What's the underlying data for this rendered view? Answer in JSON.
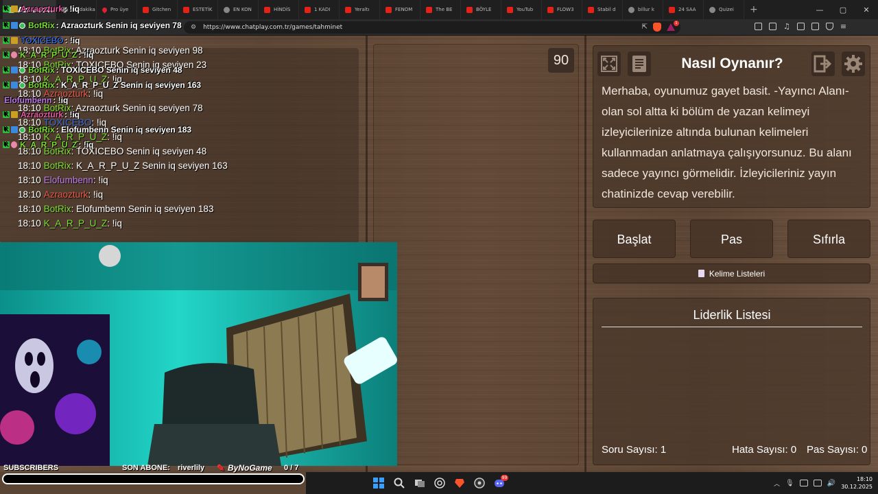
{
  "browser": {
    "tabs": [
      {
        "label": "Azraozturk: !iq",
        "icon": "twitch-icon",
        "active": true
      },
      {
        "label": "Bir dakika",
        "icon": "globe-icon"
      },
      {
        "label": "Pro üye",
        "icon": "pin-icon"
      },
      {
        "label": "Gitchen",
        "icon": "youtube-icon"
      },
      {
        "label": "ESTETİK",
        "icon": "youtube-icon"
      },
      {
        "label": "EN KON",
        "icon": "globe-icon"
      },
      {
        "label": "HİNDİS",
        "icon": "youtube-icon"
      },
      {
        "label": "1 KADI",
        "icon": "youtube-icon"
      },
      {
        "label": "Yeraltı",
        "icon": "youtube-icon"
      },
      {
        "label": "FENOM",
        "icon": "youtube-icon"
      },
      {
        "label": "The BE",
        "icon": "youtube-icon"
      },
      {
        "label": "BÖYLE",
        "icon": "youtube-icon"
      },
      {
        "label": "YouTub",
        "icon": "youtube-icon"
      },
      {
        "label": "FLOW3",
        "icon": "youtube-icon"
      },
      {
        "label": "Stabil d",
        "icon": "youtube-icon"
      },
      {
        "label": "billur k",
        "icon": "globe-icon"
      },
      {
        "label": "24 SAA",
        "icon": "youtube-icon"
      },
      {
        "label": "Quizei",
        "icon": "globe-icon"
      }
    ],
    "url": "https://www.chatplay.com.tr/games/tahminet",
    "shield_badge": "1"
  },
  "overlay_chat": [
    {
      "user": "Azraozturk",
      "msg": ": !iq",
      "color": "#e65aa4",
      "badges": [
        "sub",
        "crown"
      ]
    },
    {
      "user": "BotRix",
      "msg": ": Azraozturk Senin iq seviyen 78",
      "color": "#7dde33",
      "badges": [
        "k",
        "s",
        "v"
      ]
    },
    {
      "user": "TOXICEBO",
      "msg": ": !iq",
      "color": "#3a6bd6",
      "badges": [
        "k",
        "c"
      ]
    },
    {
      "user": "K_A_R_P_U_Z",
      "msg": ": !iq",
      "color": "#7dde33",
      "badges": [
        "k",
        "p"
      ]
    },
    {
      "user": "BotRix",
      "msg": ": TOXICEBO Senin iq seviyen 48",
      "color": "#7dde33",
      "badges": [
        "k",
        "s",
        "v"
      ]
    },
    {
      "user": "BotRix",
      "msg": ": K_A_R_P_U_Z Senin iq seviyen 163",
      "color": "#7dde33",
      "badges": [
        "k",
        "s",
        "v"
      ]
    },
    {
      "user": "Elofumbenn",
      "msg": ": !iq",
      "color": "#c07dea",
      "badges": []
    },
    {
      "user": "Azraozturk",
      "msg": ": !iq",
      "color": "#e65aa4",
      "badges": [
        "k",
        "c"
      ]
    },
    {
      "user": "BotRix",
      "msg": ": Elofumbenn Senin iq seviyen 183",
      "color": "#7dde33",
      "badges": [
        "k",
        "s",
        "v"
      ]
    },
    {
      "user": "K_A_R_P_U_Z",
      "msg": ": !iq",
      "color": "#7dde33",
      "badges": [
        "k",
        "p"
      ]
    }
  ],
  "game_chat": [
    {
      "time": "18:10",
      "user": "BotRix",
      "msg": ": Azraozturk Senin iq seviyen 98",
      "cls": "u-green"
    },
    {
      "time": "18:10",
      "user": "BotRix",
      "msg": ": TOXICEBO Senin iq seviyen 23",
      "cls": "u-green"
    },
    {
      "time": "18:10",
      "user": "K_A_R_P_U_Z",
      "msg": ": !iq",
      "cls": "u-green"
    },
    {
      "time": "18:10",
      "user": "Azraozturk",
      "msg": ": !iq",
      "cls": "u-red"
    },
    {
      "time": "18:10",
      "user": "BotRix",
      "msg": ": Azraozturk Senin iq seviyen 78",
      "cls": "u-green"
    },
    {
      "time": "18:10",
      "user": "TOXICEBO",
      "msg": ": !iq",
      "cls": "u-blue"
    },
    {
      "time": "18:10",
      "user": "K_A_R_P_U_Z",
      "msg": ": !iq",
      "cls": "u-green"
    },
    {
      "time": "18:10",
      "user": "BotRix",
      "msg": ": TOXICEBO Senin iq seviyen 48",
      "cls": "u-green"
    },
    {
      "time": "18:10",
      "user": "BotRix",
      "msg": ": K_A_R_P_U_Z Senin iq seviyen 163",
      "cls": "u-green"
    },
    {
      "time": "18:10",
      "user": "Elofumbenn",
      "msg": ": !iq",
      "cls": "u-purple"
    },
    {
      "time": "18:10",
      "user": "Azraozturk",
      "msg": ": !iq",
      "cls": "u-red"
    },
    {
      "time": "18:10",
      "user": "BotRix",
      "msg": ": Elofumbenn Senin iq seviyen 183",
      "cls": "u-green"
    },
    {
      "time": "18:10",
      "user": "K_A_R_P_U_Z",
      "msg": ": !iq",
      "cls": "u-green"
    }
  ],
  "game": {
    "timer": "90",
    "how_to_title": "Nasıl Oynanır?",
    "how_to_text": "Merhaba, oyunumuz gayet basit. -Yayıncı Alanı-olan sol altta ki bölüm de yazan kelimeyi izleyicilerinize altında bulunan kelimeleri kullanmadan anlatmaya çalışıyorsunuz. Bu alanı sadece yayıncı görmelidir. İzleyicileriniz yayın chatinizde cevap verebilir.",
    "start_label": "Başlat",
    "pass_label": "Pas",
    "reset_label": "Sıfırla",
    "word_lists_label": "Kelime Listeleri",
    "leaderboard_title": "Liderlik Listesi",
    "question_count_label": "Soru Sayısı:",
    "question_count": "1",
    "error_count_label": "Hata Sayısı:",
    "error_count": "0",
    "pass_count_label": "Pas Sayısı:",
    "pass_count": "0"
  },
  "stream": {
    "subscribers_label": "SUBSCRIBERS",
    "last_sub_label": "SON ABONE:",
    "last_sub_name": "riverlily",
    "brand": "ByNoGame",
    "goal_current": "0",
    "goal_separator": "/",
    "goal_total": "7",
    "goal_progress": 0
  },
  "taskbar": {
    "time": "18:10",
    "date": "30.12.2025",
    "discord_badge": "99"
  },
  "colors": {
    "accent_green": "#7dde33",
    "panel_brown": "#4b382a",
    "brave": "#fb542b"
  }
}
